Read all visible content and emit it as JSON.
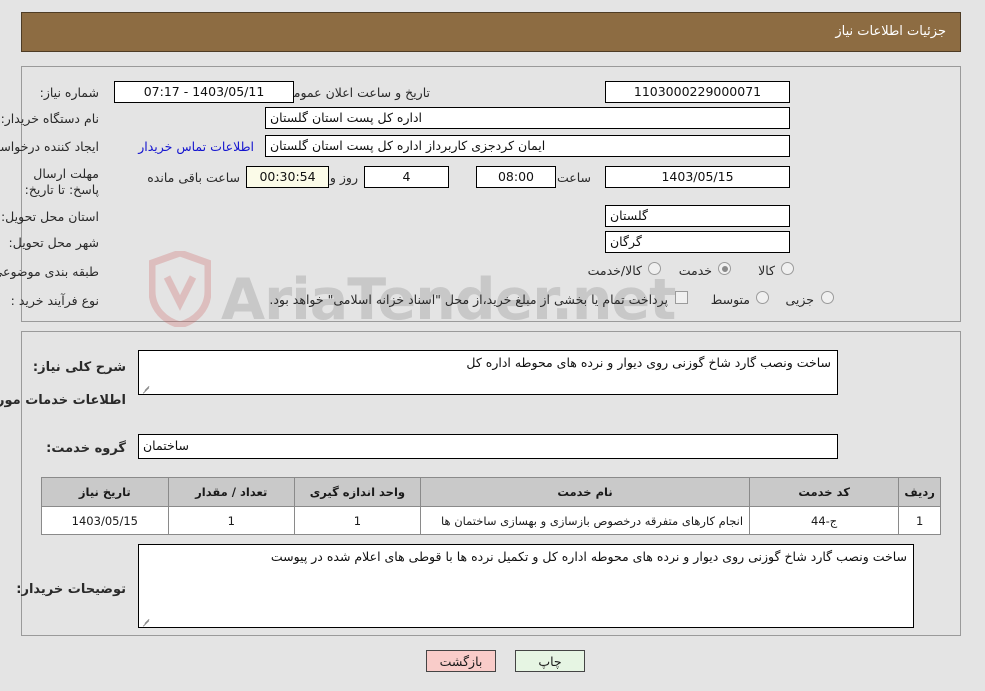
{
  "header": {
    "title": "جزئیات اطلاعات نیاز"
  },
  "top_form": {
    "need_number_label": "شماره نیاز:",
    "need_number_value": "1103000229000071",
    "public_announce_label": "تاریخ و ساعت اعلان عمومی:",
    "public_announce_value": "1403/05/11 - 07:17",
    "buyer_org_label": "نام دستگاه خریدار:",
    "buyer_org_value": "اداره کل پست استان گلستان",
    "creator_label": "ایجاد کننده درخواست:",
    "creator_value": "ایمان کردجزی کاربرداز اداره کل پست استان گلستان",
    "contact_link": "اطلاعات تماس خریدار",
    "deadline_label": "مهلت ارسال پاسخ: تا تاریخ:",
    "deadline_date": "1403/05/15",
    "hour_label": "ساعت",
    "hour_value": "08:00",
    "days_value": "4",
    "days_suffix": "روز و",
    "countdown_value": "00:30:54",
    "countdown_suffix": "ساعت باقی مانده",
    "province_label": "استان محل تحویل:",
    "province_value": "گلستان",
    "city_label": "شهر محل تحویل:",
    "city_value": "گرگان",
    "category_label": "طبقه بندی موضوعی:",
    "category_options": [
      {
        "label": "کالا",
        "selected": false
      },
      {
        "label": "خدمت",
        "selected": true
      },
      {
        "label": "کالا/خدمت",
        "selected": false
      }
    ],
    "process_label": "نوع فرآیند خرید :",
    "process_options": [
      {
        "label": "جزیی",
        "selected": false
      },
      {
        "label": "متوسط",
        "selected": false
      }
    ],
    "treasury_checkbox_label": "پرداخت تمام یا بخشی از مبلغ خرید،از محل \"اسناد خزانه اسلامی\" خواهد بود.",
    "treasury_checked": false
  },
  "bottom_form": {
    "general_desc_label": "شرح کلی نیاز:",
    "general_desc_value": "ساخت ونصب گارد شاخ گوزنی روی دیوار و نرده های محوطه اداره کل",
    "services_section_title": "اطلاعات خدمات مورد نیاز",
    "service_group_label": "گروه خدمت:",
    "service_group_value": "ساختمان",
    "buyer_notes_label": "توضیحات خریدار:",
    "buyer_notes_value": "ساخت ونصب گارد شاخ گوزنی روی دیوار و نرده های محوطه اداره کل و تکمیل نرده ها با قوطی های اعلام شده در پیوست"
  },
  "table": {
    "headers": [
      "ردیف",
      "کد خدمت",
      "نام خدمت",
      "واحد اندازه گیری",
      "تعداد / مقدار",
      "تاریخ نیاز"
    ],
    "rows": [
      {
        "row_no": "1",
        "service_code": "ج-44",
        "service_name": "انجام کارهای متفرقه درخصوص بازسازی و بهسازی ساختمان ها",
        "unit": "1",
        "quantity": "1",
        "need_date": "1403/05/15"
      }
    ]
  },
  "footer": {
    "back_label": "بازگشت",
    "print_label": "چاپ"
  },
  "watermark": {
    "text": "AriaTender.net"
  },
  "colors": {
    "header_bg": "#8d6c42",
    "page_bg": "#e4e4e4",
    "link": "#1414cf",
    "table_header_bg": "#c9c9c9",
    "back_btn_bg": "#f9ccc9",
    "print_btn_bg": "#e6f5e3",
    "countdown_bg": "#fbfbe8"
  }
}
